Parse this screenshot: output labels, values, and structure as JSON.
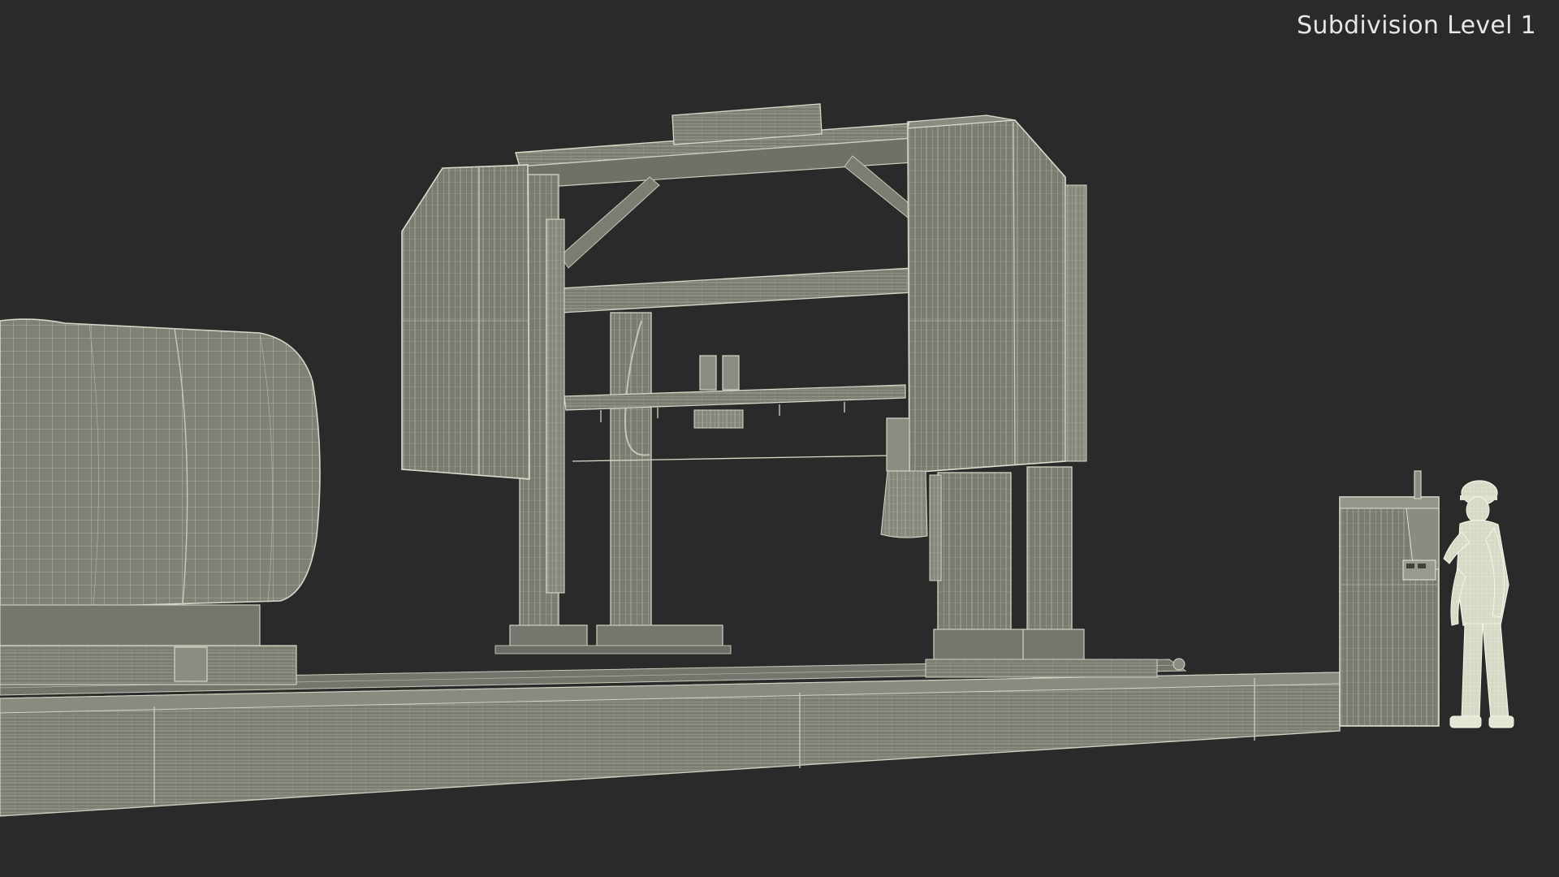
{
  "viewport": {
    "background": "#2a2a2a",
    "label": "Subdivision Level 1",
    "wire_color": "#c8c9b8"
  }
}
